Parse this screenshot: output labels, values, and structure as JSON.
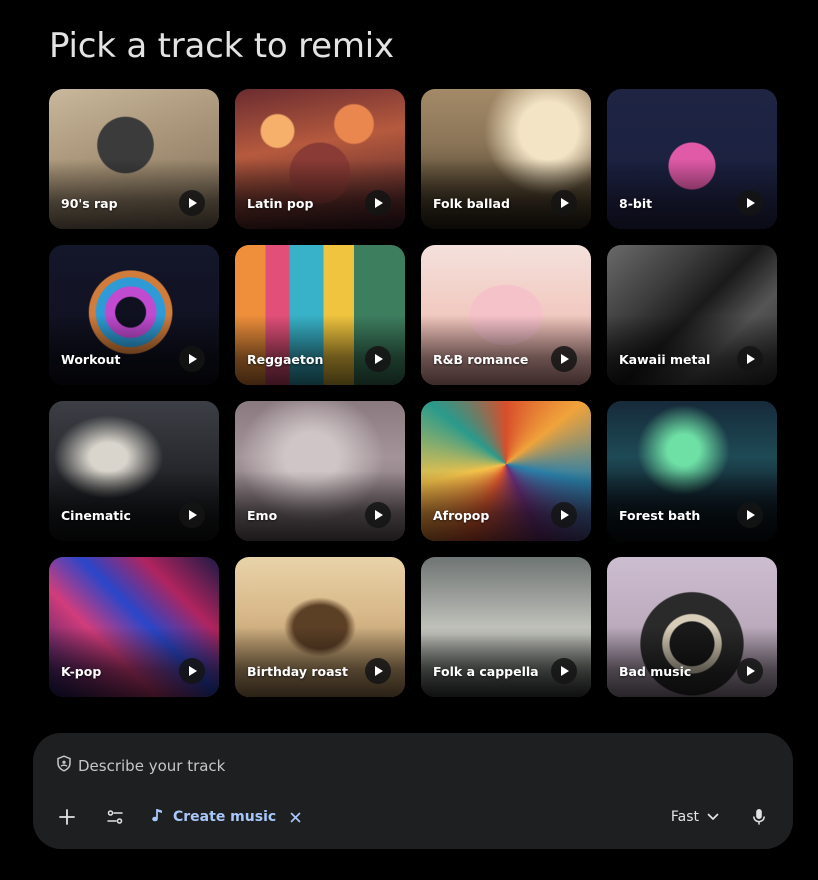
{
  "page": {
    "title": "Pick a track to remix"
  },
  "tracks": [
    {
      "label": "90's rap"
    },
    {
      "label": "Latin pop"
    },
    {
      "label": "Folk ballad"
    },
    {
      "label": "8-bit"
    },
    {
      "label": "Workout"
    },
    {
      "label": "Reggaeton"
    },
    {
      "label": "R&B romance"
    },
    {
      "label": "Kawaii metal"
    },
    {
      "label": "Cinematic"
    },
    {
      "label": "Emo"
    },
    {
      "label": "Afropop"
    },
    {
      "label": "Forest bath"
    },
    {
      "label": "K-pop"
    },
    {
      "label": "Birthday roast"
    },
    {
      "label": "Folk a cappella"
    },
    {
      "label": "Bad music"
    }
  ],
  "composer": {
    "placeholder": "Describe your track",
    "chip_label": "Create music",
    "mode_label": "Fast",
    "icons": {
      "shield": "shield-icon",
      "add": "plus-icon",
      "tools": "tune-icon",
      "music": "music-note-icon",
      "remove": "close-icon",
      "dropdown": "chevron-down-icon",
      "mic": "mic-icon"
    }
  },
  "colors": {
    "background": "#000000",
    "composer_bg": "#1e1f20",
    "accent": "#a8c7fa",
    "text": "#e3e3e3"
  }
}
